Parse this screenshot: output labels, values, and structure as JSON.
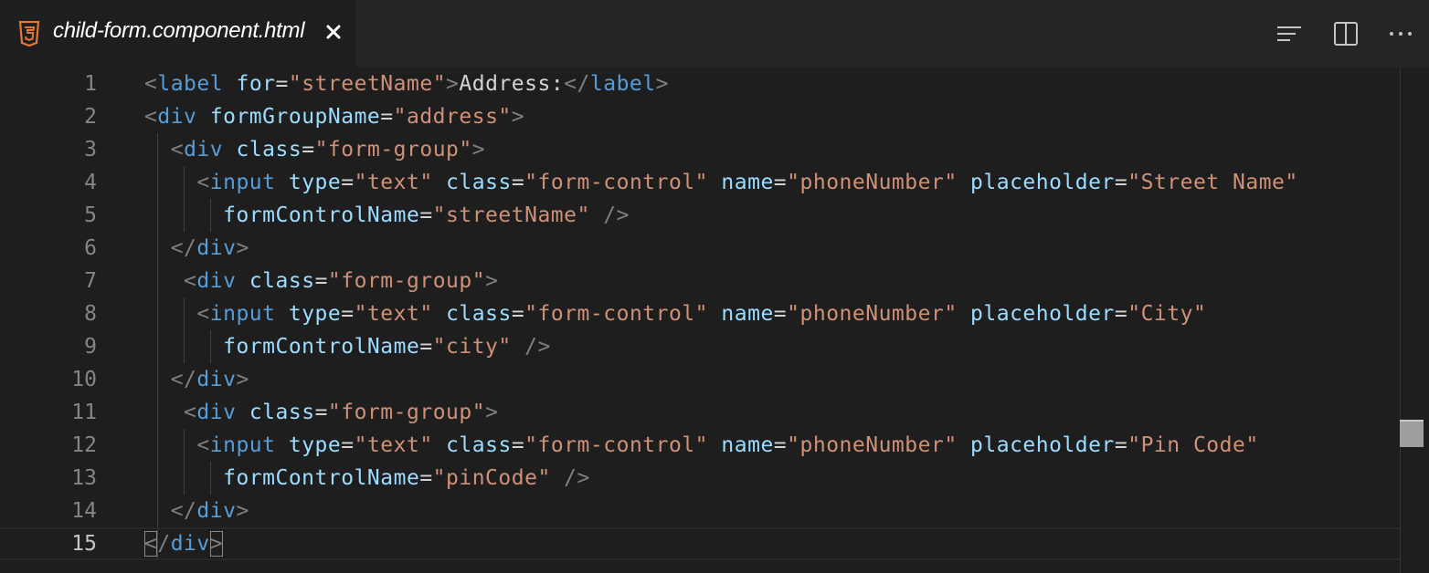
{
  "tab": {
    "title": "child-form.component.html",
    "file_icon": "html5-icon",
    "close_icon": "close-icon",
    "icon_color": "#e37933"
  },
  "toolbar": {
    "outline_icon": "list-icon",
    "split_icon": "split-editor-icon",
    "more_icon": "more-actions-icon"
  },
  "editor": {
    "current_line": 15,
    "lines": [
      {
        "n": "1",
        "tokens": [
          [
            "t-punc",
            "<"
          ],
          [
            "t-tag",
            "label"
          ],
          [
            "t-text",
            " "
          ],
          [
            "t-attr",
            "for"
          ],
          [
            "t-eq",
            "="
          ],
          [
            "t-str",
            "\"streetName\""
          ],
          [
            "t-punc",
            ">"
          ],
          [
            "t-text",
            "Address:"
          ],
          [
            "t-punc",
            "</"
          ],
          [
            "t-tag",
            "label"
          ],
          [
            "t-punc",
            ">"
          ]
        ]
      },
      {
        "n": "2",
        "tokens": [
          [
            "t-punc",
            "<"
          ],
          [
            "t-tag",
            "div"
          ],
          [
            "t-text",
            " "
          ],
          [
            "t-attr",
            "formGroupName"
          ],
          [
            "t-eq",
            "="
          ],
          [
            "t-str",
            "\"address\""
          ],
          [
            "t-punc",
            ">"
          ]
        ]
      },
      {
        "n": "3",
        "tokens": [
          [
            "t-text",
            "  "
          ],
          [
            "t-punc",
            "<"
          ],
          [
            "t-tag",
            "div"
          ],
          [
            "t-text",
            " "
          ],
          [
            "t-attr",
            "class"
          ],
          [
            "t-eq",
            "="
          ],
          [
            "t-str",
            "\"form-group\""
          ],
          [
            "t-punc",
            ">"
          ]
        ]
      },
      {
        "n": "4",
        "tokens": [
          [
            "t-text",
            "    "
          ],
          [
            "t-punc",
            "<"
          ],
          [
            "t-tag",
            "input"
          ],
          [
            "t-text",
            " "
          ],
          [
            "t-attr",
            "type"
          ],
          [
            "t-eq",
            "="
          ],
          [
            "t-str",
            "\"text\""
          ],
          [
            "t-text",
            " "
          ],
          [
            "t-attr",
            "class"
          ],
          [
            "t-eq",
            "="
          ],
          [
            "t-str",
            "\"form-control\""
          ],
          [
            "t-text",
            " "
          ],
          [
            "t-attr",
            "name"
          ],
          [
            "t-eq",
            "="
          ],
          [
            "t-str",
            "\"phoneNumber\""
          ],
          [
            "t-text",
            " "
          ],
          [
            "t-attr",
            "placeholder"
          ],
          [
            "t-eq",
            "="
          ],
          [
            "t-str",
            "\"Street Name\""
          ]
        ]
      },
      {
        "n": "5",
        "tokens": [
          [
            "t-text",
            "      "
          ],
          [
            "t-attr",
            "formControlName"
          ],
          [
            "t-eq",
            "="
          ],
          [
            "t-str",
            "\"streetName\""
          ],
          [
            "t-text",
            " "
          ],
          [
            "t-punc",
            "/>"
          ]
        ]
      },
      {
        "n": "6",
        "tokens": [
          [
            "t-text",
            "  "
          ],
          [
            "t-punc",
            "</"
          ],
          [
            "t-tag",
            "div"
          ],
          [
            "t-punc",
            ">"
          ]
        ]
      },
      {
        "n": "7",
        "tokens": [
          [
            "t-text",
            "   "
          ],
          [
            "t-punc",
            "<"
          ],
          [
            "t-tag",
            "div"
          ],
          [
            "t-text",
            " "
          ],
          [
            "t-attr",
            "class"
          ],
          [
            "t-eq",
            "="
          ],
          [
            "t-str",
            "\"form-group\""
          ],
          [
            "t-punc",
            ">"
          ]
        ]
      },
      {
        "n": "8",
        "tokens": [
          [
            "t-text",
            "    "
          ],
          [
            "t-punc",
            "<"
          ],
          [
            "t-tag",
            "input"
          ],
          [
            "t-text",
            " "
          ],
          [
            "t-attr",
            "type"
          ],
          [
            "t-eq",
            "="
          ],
          [
            "t-str",
            "\"text\""
          ],
          [
            "t-text",
            " "
          ],
          [
            "t-attr",
            "class"
          ],
          [
            "t-eq",
            "="
          ],
          [
            "t-str",
            "\"form-control\""
          ],
          [
            "t-text",
            " "
          ],
          [
            "t-attr",
            "name"
          ],
          [
            "t-eq",
            "="
          ],
          [
            "t-str",
            "\"phoneNumber\""
          ],
          [
            "t-text",
            " "
          ],
          [
            "t-attr",
            "placeholder"
          ],
          [
            "t-eq",
            "="
          ],
          [
            "t-str",
            "\"City\""
          ]
        ]
      },
      {
        "n": "9",
        "tokens": [
          [
            "t-text",
            "      "
          ],
          [
            "t-attr",
            "formControlName"
          ],
          [
            "t-eq",
            "="
          ],
          [
            "t-str",
            "\"city\""
          ],
          [
            "t-text",
            " "
          ],
          [
            "t-punc",
            "/>"
          ]
        ]
      },
      {
        "n": "10",
        "tokens": [
          [
            "t-text",
            "  "
          ],
          [
            "t-punc",
            "</"
          ],
          [
            "t-tag",
            "div"
          ],
          [
            "t-punc",
            ">"
          ]
        ]
      },
      {
        "n": "11",
        "tokens": [
          [
            "t-text",
            "   "
          ],
          [
            "t-punc",
            "<"
          ],
          [
            "t-tag",
            "div"
          ],
          [
            "t-text",
            " "
          ],
          [
            "t-attr",
            "class"
          ],
          [
            "t-eq",
            "="
          ],
          [
            "t-str",
            "\"form-group\""
          ],
          [
            "t-punc",
            ">"
          ]
        ]
      },
      {
        "n": "12",
        "tokens": [
          [
            "t-text",
            "    "
          ],
          [
            "t-punc",
            "<"
          ],
          [
            "t-tag",
            "input"
          ],
          [
            "t-text",
            " "
          ],
          [
            "t-attr",
            "type"
          ],
          [
            "t-eq",
            "="
          ],
          [
            "t-str",
            "\"text\""
          ],
          [
            "t-text",
            " "
          ],
          [
            "t-attr",
            "class"
          ],
          [
            "t-eq",
            "="
          ],
          [
            "t-str",
            "\"form-control\""
          ],
          [
            "t-text",
            " "
          ],
          [
            "t-attr",
            "name"
          ],
          [
            "t-eq",
            "="
          ],
          [
            "t-str",
            "\"phoneNumber\""
          ],
          [
            "t-text",
            " "
          ],
          [
            "t-attr",
            "placeholder"
          ],
          [
            "t-eq",
            "="
          ],
          [
            "t-str",
            "\"Pin Code\""
          ]
        ]
      },
      {
        "n": "13",
        "tokens": [
          [
            "t-text",
            "      "
          ],
          [
            "t-attr",
            "formControlName"
          ],
          [
            "t-eq",
            "="
          ],
          [
            "t-str",
            "\"pinCode\""
          ],
          [
            "t-text",
            " "
          ],
          [
            "t-punc",
            "/>"
          ]
        ]
      },
      {
        "n": "14",
        "tokens": [
          [
            "t-text",
            "  "
          ],
          [
            "t-punc",
            "</"
          ],
          [
            "t-tag",
            "div"
          ],
          [
            "t-punc",
            ">"
          ]
        ]
      },
      {
        "n": "15",
        "tokens": [
          [
            "t-punc",
            "</"
          ],
          [
            "t-tag",
            "div"
          ],
          [
            "t-punc",
            ">"
          ]
        ]
      }
    ]
  }
}
